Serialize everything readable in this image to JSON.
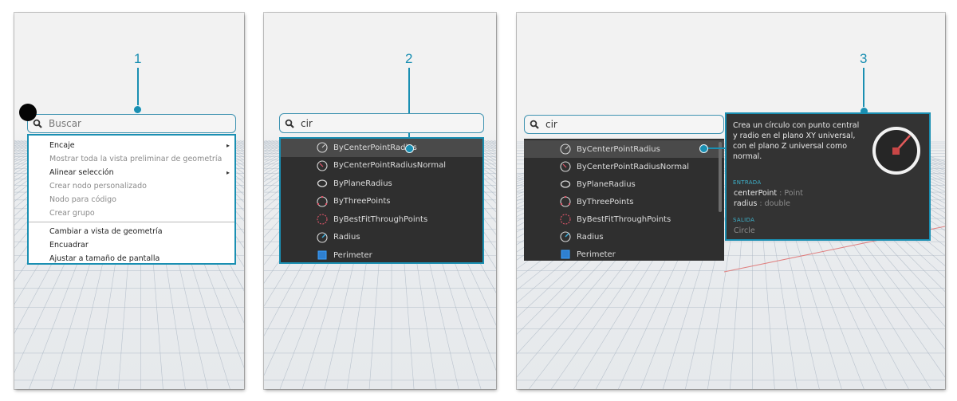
{
  "callouts": [
    "1",
    "2",
    "3"
  ],
  "panel1": {
    "search_placeholder": "Buscar",
    "menu": [
      {
        "label": "Encaje",
        "enabled": true,
        "submenu": true
      },
      {
        "label": "Mostrar toda la vista preliminar de geometría",
        "enabled": false,
        "submenu": false
      },
      {
        "label": "Alinear selección",
        "enabled": true,
        "submenu": true
      },
      {
        "label": "Crear nodo personalizado",
        "enabled": false,
        "submenu": false
      },
      {
        "label": "Nodo para código",
        "enabled": false,
        "submenu": false
      },
      {
        "label": "Crear grupo",
        "enabled": false,
        "submenu": false
      },
      {
        "label": "Cambiar a vista de geometría",
        "enabled": true,
        "submenu": false
      },
      {
        "label": "Encuadrar",
        "enabled": true,
        "submenu": false
      },
      {
        "label": "Ajustar a tamaño de pantalla",
        "enabled": true,
        "submenu": false
      }
    ],
    "submenu_arrow": "▸"
  },
  "search_query": "cir",
  "results": [
    {
      "label": "ByCenterPointRadius",
      "icon": "circle-center-radius-icon"
    },
    {
      "label": "ByCenterPointRadiusNormal",
      "icon": "circle-normal-icon"
    },
    {
      "label": "ByPlaneRadius",
      "icon": "ellipse-plane-icon"
    },
    {
      "label": "ByThreePoints",
      "icon": "circle-three-points-icon"
    },
    {
      "label": "ByBestFitThroughPoints",
      "icon": "circle-best-fit-icon"
    },
    {
      "label": "Radius",
      "icon": "radius-icon"
    },
    {
      "label": "Perimeter",
      "icon": "perimeter-icon"
    }
  ],
  "tooltip": {
    "description": "Crea un círculo con punto central y radio en el plano XY universal, con el plano Z universal como normal.",
    "input_header": "ENTRADA",
    "inputs": [
      {
        "name": "centerPoint",
        "sep": " : ",
        "type": "Point"
      },
      {
        "name": "radius",
        "sep": " : ",
        "type": "double"
      }
    ],
    "output_header": "SALIDA",
    "output": "Circle"
  },
  "colors": {
    "accent": "#1a8fb2",
    "dark_bg": "#2f2f2f",
    "selected": "#4a4a4a"
  }
}
